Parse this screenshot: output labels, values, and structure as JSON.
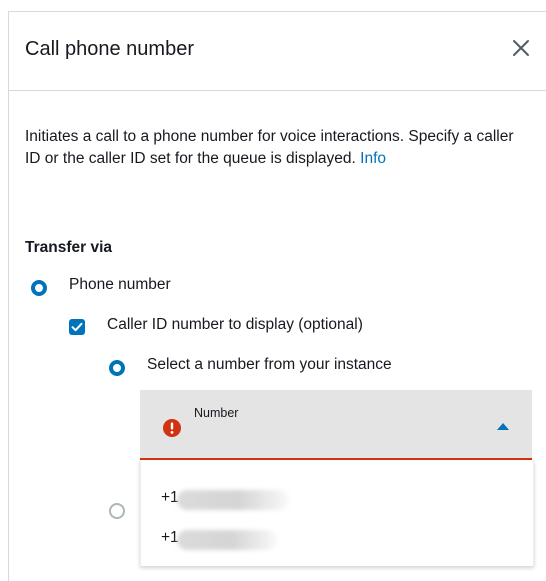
{
  "header": {
    "title": "Call phone number",
    "close_icon": "close-icon"
  },
  "description": {
    "text": "Initiates a call to a phone number for voice interactions. Specify a caller ID or the caller ID set for the queue is displayed.",
    "info_link": "Info"
  },
  "transfer": {
    "label": "Transfer via",
    "phone_number_option": {
      "label": "Phone number",
      "selected": true
    },
    "caller_id_checkbox": {
      "label": "Caller ID number to display (optional)",
      "checked": true
    },
    "caller_id_source": {
      "instance_option_label": "Select a number from your instance",
      "selected": "instance"
    }
  },
  "number_select": {
    "label": "Number",
    "error_icon": "error-icon",
    "caret_icon": "caret-up-icon",
    "state": "open",
    "options": [
      {
        "value": "+1"
      },
      {
        "value": "+1"
      }
    ]
  },
  "colors": {
    "accent": "#0073bb",
    "error": "#d13212",
    "select_bg": "#e4e4e4"
  }
}
